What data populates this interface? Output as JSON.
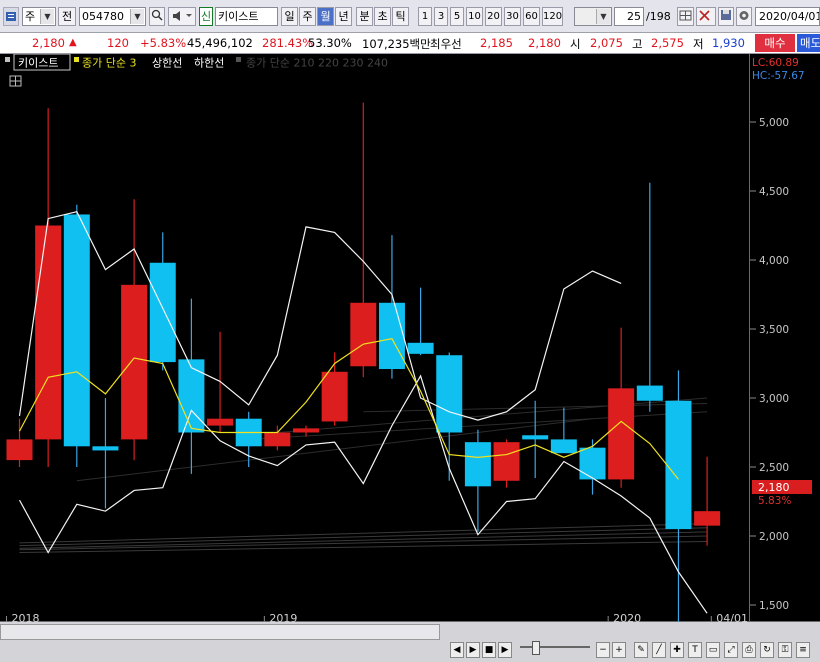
{
  "toolbar": {
    "market_type": "주",
    "prev_label": "전",
    "stock_code": "054780",
    "badge": "신",
    "stock_name": "키이스트",
    "periods": [
      "일",
      "주",
      "월",
      "년",
      "분",
      "초",
      "틱"
    ],
    "selected_period": "월",
    "numbers": [
      "1",
      "3",
      "5",
      "10",
      "20",
      "30",
      "60",
      "120"
    ],
    "page": "25",
    "total": "/198",
    "date": "2020/04/01"
  },
  "quote": {
    "price": "2,180",
    "change_arrow": "▲",
    "change": "120",
    "change_pct": "+5.83%",
    "volume": "45,496,102",
    "volume_ratio": "281.43%",
    "turnover": "53.30%",
    "amount": "107,235백만",
    "best_ask_label": "최우선",
    "best_ask": "2,185",
    "best_bid": "2,180",
    "open_label": "시",
    "open": "2,075",
    "high_label": "고",
    "high": "2,575",
    "low_label": "저",
    "low": "1,930",
    "buy_label": "매수",
    "sell_label": "매도"
  },
  "legend": {
    "name": "키이스트",
    "ma_label": "종가 단순 3",
    "upper_label": "상한선",
    "lower_label": "하한선",
    "vol_label": "종가 단순 210 220 230 240"
  },
  "corner": {
    "lc": "LC:60.89",
    "hc": "HC:-57.67"
  },
  "price_tag": {
    "value": "2,180",
    "pct": "5.83%"
  },
  "chart_data": {
    "type": "candlestick",
    "y_ticks": [
      "5,000",
      "4,500",
      "4,000",
      "3,500",
      "3,000",
      "2,500",
      "2,000",
      "1,500"
    ],
    "ylim": [
      1250,
      5250
    ],
    "x_labels": [
      {
        "label": "2018",
        "index": 0
      },
      {
        "label": "2019",
        "index": 9
      },
      {
        "label": "2020",
        "index": 21
      },
      {
        "label": "04/01",
        "index": 24.6
      }
    ],
    "candles": [
      {
        "o": 2550,
        "h": 2850,
        "l": 2500,
        "c": 2700
      },
      {
        "o": 2700,
        "h": 5100,
        "l": 2500,
        "c": 4250
      },
      {
        "o": 4330,
        "h": 4400,
        "l": 2500,
        "c": 2650
      },
      {
        "o": 2650,
        "h": 3000,
        "l": 2200,
        "c": 2620
      },
      {
        "o": 2700,
        "h": 4440,
        "l": 2550,
        "c": 3820
      },
      {
        "o": 3980,
        "h": 4200,
        "l": 3200,
        "c": 3260
      },
      {
        "o": 3280,
        "h": 3720,
        "l": 2450,
        "c": 2750
      },
      {
        "o": 2800,
        "h": 3480,
        "l": 2750,
        "c": 2850
      },
      {
        "o": 2850,
        "h": 2900,
        "l": 2500,
        "c": 2650
      },
      {
        "o": 2650,
        "h": 2800,
        "l": 2620,
        "c": 2750
      },
      {
        "o": 2750,
        "h": 2800,
        "l": 2720,
        "c": 2780
      },
      {
        "o": 2830,
        "h": 3330,
        "l": 2800,
        "c": 3190
      },
      {
        "o": 3230,
        "h": 5140,
        "l": 3150,
        "c": 3690
      },
      {
        "o": 3690,
        "h": 4180,
        "l": 3140,
        "c": 3210
      },
      {
        "o": 3400,
        "h": 3800,
        "l": 3310,
        "c": 3320
      },
      {
        "o": 3310,
        "h": 3330,
        "l": 2400,
        "c": 2750
      },
      {
        "o": 2680,
        "h": 2770,
        "l": 2030,
        "c": 2360
      },
      {
        "o": 2400,
        "h": 2700,
        "l": 2350,
        "c": 2680
      },
      {
        "o": 2730,
        "h": 2980,
        "l": 2420,
        "c": 2700
      },
      {
        "o": 2700,
        "h": 2930,
        "l": 2610,
        "c": 2600
      },
      {
        "o": 2640,
        "h": 2700,
        "l": 2300,
        "c": 2410
      },
      {
        "o": 2410,
        "h": 3510,
        "l": 2350,
        "c": 3070
      },
      {
        "o": 3090,
        "h": 4560,
        "l": 2900,
        "c": 2980
      },
      {
        "o": 2980,
        "h": 3200,
        "l": 1360,
        "c": 2050
      },
      {
        "o": 2075,
        "h": 2575,
        "l": 1930,
        "c": 2180
      }
    ],
    "ma": [
      2760,
      3150,
      3190,
      3030,
      3290,
      3250,
      2780,
      2750,
      2750,
      2750,
      2970,
      3250,
      3390,
      3430,
      3050,
      2590,
      2570,
      2590,
      2660,
      2570,
      2650,
      2830,
      2670,
      2410,
      null
    ],
    "upper": [
      2870,
      4300,
      4350,
      3930,
      4080,
      3650,
      3220,
      3120,
      2950,
      3310,
      4240,
      4200,
      3990,
      3750,
      3000,
      2900,
      2840,
      2900,
      3060,
      3790,
      3920,
      3830,
      null,
      null,
      null
    ],
    "lower": [
      2260,
      1880,
      2230,
      2180,
      2330,
      2350,
      2910,
      2690,
      2580,
      2510,
      2660,
      2680,
      2380,
      2800,
      3160,
      2490,
      2010,
      2250,
      2270,
      2540,
      2420,
      2290,
      2130,
      1740,
      1440
    ]
  }
}
